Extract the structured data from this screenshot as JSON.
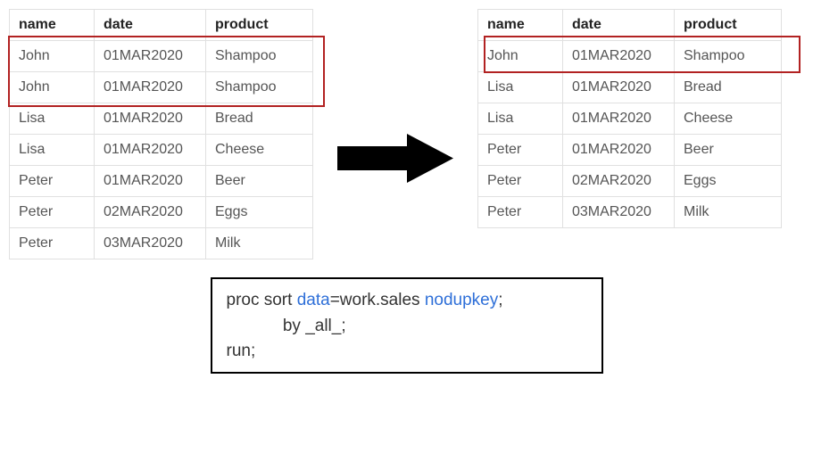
{
  "headers": {
    "name": "name",
    "date": "date",
    "product": "product"
  },
  "left_table": [
    {
      "name": "John",
      "date": "01MAR2020",
      "product": "Shampoo"
    },
    {
      "name": "John",
      "date": "01MAR2020",
      "product": "Shampoo"
    },
    {
      "name": "Lisa",
      "date": "01MAR2020",
      "product": "Bread"
    },
    {
      "name": "Lisa",
      "date": "01MAR2020",
      "product": "Cheese"
    },
    {
      "name": "Peter",
      "date": "01MAR2020",
      "product": "Beer"
    },
    {
      "name": "Peter",
      "date": "02MAR2020",
      "product": "Eggs"
    },
    {
      "name": "Peter",
      "date": "03MAR2020",
      "product": "Milk"
    }
  ],
  "right_table": [
    {
      "name": "John",
      "date": "01MAR2020",
      "product": "Shampoo"
    },
    {
      "name": "Lisa",
      "date": "01MAR2020",
      "product": "Bread"
    },
    {
      "name": "Lisa",
      "date": "01MAR2020",
      "product": "Cheese"
    },
    {
      "name": "Peter",
      "date": "01MAR2020",
      "product": "Beer"
    },
    {
      "name": "Peter",
      "date": "02MAR2020",
      "product": "Eggs"
    },
    {
      "name": "Peter",
      "date": "03MAR2020",
      "product": "Milk"
    }
  ],
  "code": {
    "proc": "proc sort ",
    "data_kw": "data",
    "eq": "=work.sales ",
    "nodupkey": "nodupkey",
    "semi": ";",
    "by_line": "            by _all_;",
    "run": "run;"
  }
}
